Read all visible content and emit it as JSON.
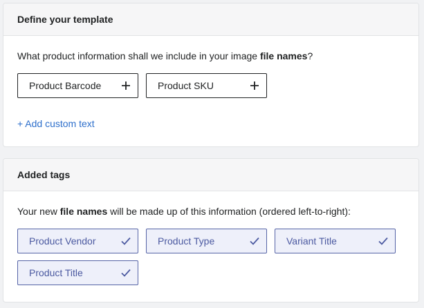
{
  "template_card": {
    "title": "Define your template",
    "desc_prefix": "What product information shall we include in your image ",
    "desc_bold": "file names",
    "desc_suffix": "?",
    "options": [
      {
        "label": "Product Barcode",
        "icon": "plus-icon"
      },
      {
        "label": "Product SKU",
        "icon": "plus-icon"
      }
    ],
    "add_custom_text": "+ Add custom text"
  },
  "tags_card": {
    "title": "Added tags",
    "desc_prefix": "Your new ",
    "desc_bold": "file names",
    "desc_suffix": " will be made up of this information (ordered left-to-right):",
    "tags": [
      {
        "label": "Product Vendor",
        "icon": "check-icon"
      },
      {
        "label": "Product Type",
        "icon": "check-icon"
      },
      {
        "label": "Variant Title",
        "icon": "check-icon"
      },
      {
        "label": "Product Title",
        "icon": "check-icon"
      }
    ]
  },
  "colors": {
    "background": "#f1f2f4",
    "card": "#ffffff",
    "header": "#f6f6f7",
    "link": "#2c6ecb",
    "tag_border": "#5563a6",
    "tag_fill": "#eef0fa",
    "tag_text": "#4b59a0"
  }
}
